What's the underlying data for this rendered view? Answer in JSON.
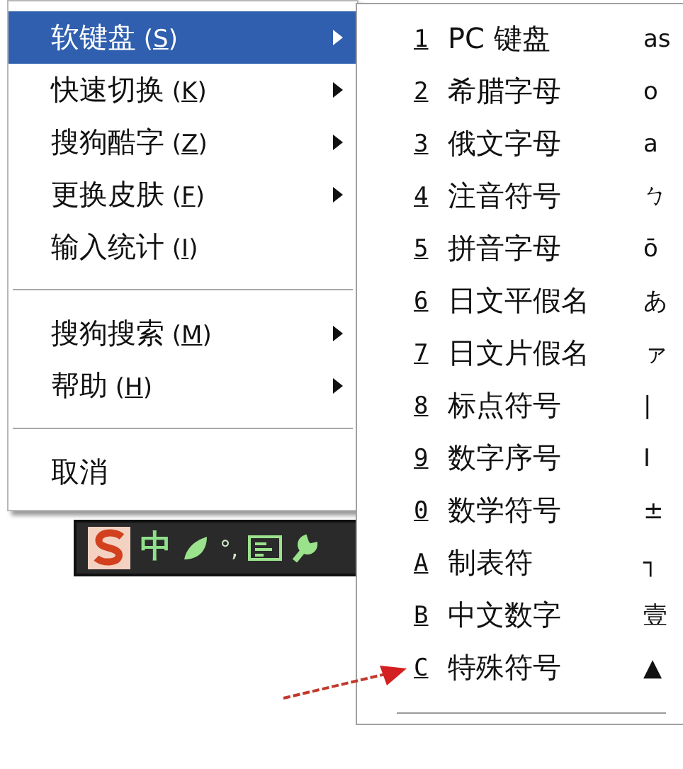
{
  "menu": {
    "items": [
      {
        "kind": "item",
        "label": "软键盘",
        "access_key": "(S)",
        "has_submenu": true,
        "selected": true
      },
      {
        "kind": "item",
        "label": "快速切换",
        "access_key": "(K)",
        "has_submenu": true,
        "selected": false
      },
      {
        "kind": "item",
        "label": "搜狗酷字",
        "access_key": "(Z)",
        "has_submenu": true,
        "selected": false
      },
      {
        "kind": "item",
        "label": "更换皮肤",
        "access_key": "(F)",
        "has_submenu": true,
        "selected": false
      },
      {
        "kind": "item",
        "label": "输入统计",
        "access_key": "(I)",
        "has_submenu": false,
        "selected": false
      },
      {
        "kind": "separator"
      },
      {
        "kind": "item",
        "label": "搜狗搜索",
        "access_key": "(M)",
        "has_submenu": true,
        "selected": false
      },
      {
        "kind": "item",
        "label": "帮助",
        "access_key": "(H)",
        "has_submenu": true,
        "selected": false
      },
      {
        "kind": "separator"
      },
      {
        "kind": "item",
        "label": "取消",
        "has_submenu": false,
        "selected": false
      }
    ]
  },
  "submenu": {
    "items": [
      {
        "key": "1",
        "label": "PC 键盘",
        "preview": "as"
      },
      {
        "key": "2",
        "label": "希腊字母",
        "preview": "ο"
      },
      {
        "key": "3",
        "label": "俄文字母",
        "preview": "а"
      },
      {
        "key": "4",
        "label": "注音符号",
        "preview": "ㄅ"
      },
      {
        "key": "5",
        "label": "拼音字母",
        "preview": "ō"
      },
      {
        "key": "6",
        "label": "日文平假名",
        "preview": "あ"
      },
      {
        "key": "7",
        "label": "日文片假名",
        "preview": "ァ"
      },
      {
        "key": "8",
        "label": "标点符号",
        "preview": "|"
      },
      {
        "key": "9",
        "label": "数字序号",
        "preview": "Ⅰ"
      },
      {
        "key": "0",
        "label": "数学符号",
        "preview": "±"
      },
      {
        "key": "A",
        "label": "制表符",
        "preview": "┐"
      },
      {
        "key": "B",
        "label": "中文数字",
        "preview": "壹"
      },
      {
        "key": "C",
        "label": "特殊符号",
        "preview": "▲"
      }
    ]
  },
  "toolbar": {
    "language": "中",
    "punctuation": "°,"
  }
}
